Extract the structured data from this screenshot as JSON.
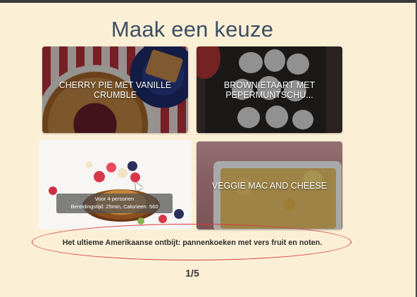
{
  "header": {
    "title": "Maak een keuze"
  },
  "recipes": [
    {
      "title": "CHERRY PIE MET VANILLE CRUMBLE"
    },
    {
      "title": "BROWNIETAART MET PEPERMUNTSCHU..."
    },
    {
      "title": "",
      "info_line1": "Voor 4 personen",
      "info_line2": "Bereidingstijd: 25min, Calorieen: 560"
    },
    {
      "title": "VEGGIE MAC AND CHEESE"
    }
  ],
  "caption": "Het ultieme Amerikaanse ontbijt: pannenkoeken met vers fruit en noten.",
  "pager": "1/5",
  "colors": {
    "background": "#fbf0d6",
    "title": "#3b4e63",
    "annotation": "#d9393b"
  }
}
